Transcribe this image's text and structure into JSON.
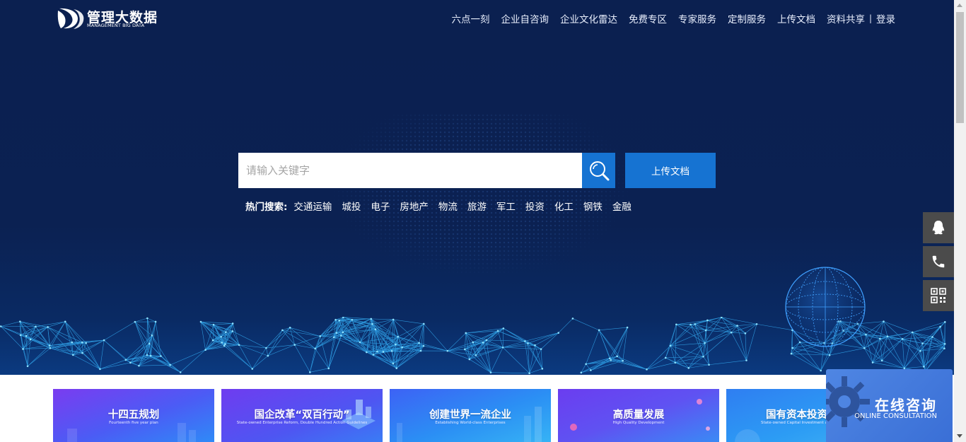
{
  "header": {
    "logo_title": "管理大数据",
    "logo_subtitle": "MANAGEMENT BIG DATA",
    "nav": [
      "六点一刻",
      "企业自咨询",
      "企业文化雷达",
      "免费专区",
      "专家服务",
      "定制服务",
      "上传文档",
      "资料共享"
    ],
    "separator": "|",
    "login": "登录"
  },
  "search": {
    "placeholder": "请输入关键字",
    "button_icon": "search-icon",
    "upload_label": "上传文档"
  },
  "hot_search": {
    "label": "热门搜索:",
    "items": [
      "交通运输",
      "城投",
      "电子",
      "房地产",
      "物流",
      "旅游",
      "军工",
      "投资",
      "化工",
      "钢铁",
      "金融"
    ]
  },
  "side_tools": [
    {
      "icon": "qq-icon"
    },
    {
      "icon": "phone-icon"
    },
    {
      "icon": "qr-code-icon"
    }
  ],
  "cards": [
    {
      "title": "十四五规划",
      "subtitle": "Fourteenth five year plan"
    },
    {
      "title": "国企改革“双百行动”",
      "subtitle": "State-owned Enterprise Reform, Double Hundred Action Guidelines"
    },
    {
      "title": "创建世界一流企业",
      "subtitle": "Establishing World-class Enterprises"
    },
    {
      "title": "高质量发展",
      "subtitle": "High Quality Development"
    },
    {
      "title": "国有资本投资运营",
      "subtitle": "State-owned Capital Investment and Operation"
    }
  ],
  "consult": {
    "title": "在线咨询",
    "subtitle": "ONLINE CONSULTATION"
  },
  "colors": {
    "hero_bg": "#0b2050",
    "accent_blue": "#1673d2",
    "side_tool_bg": "#4b4b4b",
    "consult_bg": "#4f86e3"
  }
}
